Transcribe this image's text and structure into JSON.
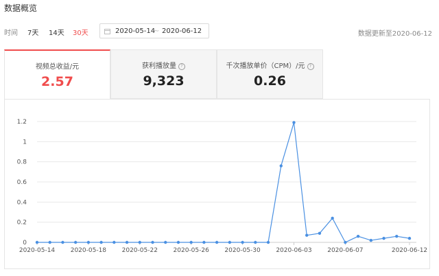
{
  "page": {
    "title": "数据概览"
  },
  "filters": {
    "time_label": "时间",
    "ranges": [
      {
        "label": "7天",
        "active": false
      },
      {
        "label": "14天",
        "active": false
      },
      {
        "label": "30天",
        "active": true
      }
    ],
    "date_start": "2020-05-14",
    "date_end": "2020-06-12",
    "separator": "~",
    "update_text": "数据更新至2020-06-12"
  },
  "metrics": [
    {
      "label": "视频总收益/元",
      "value": "2.57",
      "active": true,
      "help": false
    },
    {
      "label": "获利播放量",
      "value": "9,323",
      "active": false,
      "help": true
    },
    {
      "label": "千次播放单价（CPM）/元",
      "value": "0.26",
      "active": false,
      "help": true
    }
  ],
  "colors": {
    "accent": "#f04c4c",
    "line": "#4a90e2"
  },
  "chart_data": {
    "type": "line",
    "x": [
      "2020-05-14",
      "2020-05-15",
      "2020-05-16",
      "2020-05-17",
      "2020-05-18",
      "2020-05-19",
      "2020-05-20",
      "2020-05-21",
      "2020-05-22",
      "2020-05-23",
      "2020-05-24",
      "2020-05-25",
      "2020-05-26",
      "2020-05-27",
      "2020-05-28",
      "2020-05-29",
      "2020-05-30",
      "2020-05-31",
      "2020-06-01",
      "2020-06-02",
      "2020-06-03",
      "2020-06-04",
      "2020-06-05",
      "2020-06-06",
      "2020-06-07",
      "2020-06-08",
      "2020-06-09",
      "2020-06-10",
      "2020-06-11",
      "2020-06-12"
    ],
    "values": [
      0,
      0,
      0,
      0,
      0,
      0,
      0,
      0,
      0,
      0,
      0,
      0,
      0,
      0,
      0,
      0,
      0,
      0,
      0,
      0.76,
      1.19,
      0.07,
      0.09,
      0.24,
      0,
      0.06,
      0.02,
      0.04,
      0.06,
      0.04
    ],
    "x_tick_labels": [
      "2020-05-14",
      "2020-05-18",
      "2020-05-22",
      "2020-05-26",
      "2020-05-30",
      "2020-06-03",
      "2020-06-07",
      "2020-06-12"
    ],
    "y_ticks": [
      0,
      0.2,
      0.4,
      0.6,
      0.8,
      1,
      1.2
    ],
    "ylim": [
      0,
      1.2
    ],
    "grid": true
  }
}
